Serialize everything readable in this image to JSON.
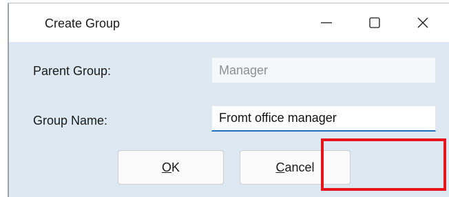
{
  "window": {
    "title": "Create Group",
    "controls": {
      "minimize_icon": "minimize-icon",
      "maximize_icon": "maximize-icon",
      "close_icon": "close-icon"
    }
  },
  "form": {
    "parent_group_label": "Parent Group:",
    "parent_group_value": "Manager",
    "group_name_label": "Group Name:",
    "group_name_value": "Fromt office manager"
  },
  "buttons": {
    "ok_label": "OK",
    "cancel_label": "Cancel"
  },
  "colors": {
    "dialog_background": "#dde8f2",
    "focus_underline": "#1f6fc0",
    "highlight_box": "#e8141b"
  }
}
